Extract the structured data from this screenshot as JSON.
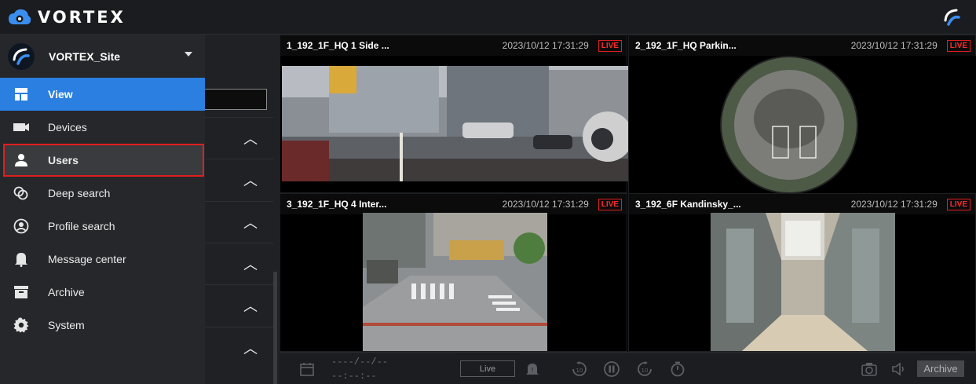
{
  "app": {
    "brand": "VORTEX"
  },
  "sidebar": {
    "site_name": "VORTEX_Site",
    "items": [
      {
        "label": "View",
        "icon": "view-grid-icon",
        "active": true
      },
      {
        "label": "Devices",
        "icon": "camera-icon"
      },
      {
        "label": "Users",
        "icon": "user-icon",
        "highlighted": true
      },
      {
        "label": "Deep search",
        "icon": "deep-search-icon"
      },
      {
        "label": "Profile search",
        "icon": "profile-icon"
      },
      {
        "label": "Message center",
        "icon": "bell-icon"
      },
      {
        "label": "Archive",
        "icon": "archive-box-icon"
      },
      {
        "label": "System",
        "icon": "gear-icon"
      }
    ]
  },
  "video_grid": [
    {
      "title": "1_192_1F_HQ 1 Side ...",
      "timestamp": "2023/10/12 17:31:29",
      "badge": "LIVE"
    },
    {
      "title": "2_192_1F_HQ Parkin...",
      "timestamp": "2023/10/12 17:31:29",
      "badge": "LIVE"
    },
    {
      "title": "3_192_1F_HQ 4 Inter...",
      "timestamp": "2023/10/12 17:31:29",
      "badge": "LIVE"
    },
    {
      "title": "3_192_6F Kandinsky_...",
      "timestamp": "2023/10/12 17:31:29",
      "badge": "LIVE"
    }
  ],
  "playback": {
    "date_placeholder": "----/--/--",
    "time_placeholder": "--:--:--",
    "live_label": "Live",
    "archive_label": "Archive"
  },
  "colors": {
    "accent": "#2a7fe0",
    "live_red": "#e01e1e",
    "highlight_red": "#e01e1e"
  }
}
